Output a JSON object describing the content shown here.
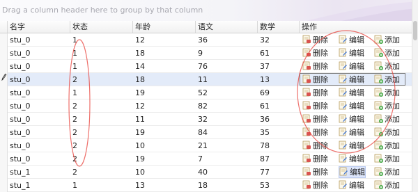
{
  "group_panel": {
    "hint": "Drag a column header here to group by that column"
  },
  "columns": {
    "name": "名字",
    "status": "状态",
    "age": "年龄",
    "chinese": "语文",
    "math": "数学",
    "ops": "操作"
  },
  "actions": {
    "delete": "删除",
    "edit": "编辑",
    "add": "添加"
  },
  "icons": {
    "delete": "delete-doc-icon",
    "edit": "edit-doc-icon",
    "add": "add-doc-icon",
    "row_editing": "pencil-icon"
  },
  "colors": {
    "selected_row": "#e3ebf9",
    "annotation": "#e8403a"
  },
  "selected_row_index": 3,
  "rows": [
    {
      "name": "stu_0",
      "status": "1",
      "age": "12",
      "chinese": "36",
      "math": "32"
    },
    {
      "name": "stu_0",
      "status": "1",
      "age": "18",
      "chinese": "9",
      "math": "61"
    },
    {
      "name": "stu_0",
      "status": "1",
      "age": "14",
      "chinese": "76",
      "math": "37"
    },
    {
      "name": "stu_0",
      "status": "2",
      "age": "18",
      "chinese": "11",
      "math": "13"
    },
    {
      "name": "stu_0",
      "status": "1",
      "age": "19",
      "chinese": "52",
      "math": "69"
    },
    {
      "name": "stu_0",
      "status": "2",
      "age": "12",
      "chinese": "82",
      "math": "61"
    },
    {
      "name": "stu_0",
      "status": "2",
      "age": "11",
      "chinese": "32",
      "math": "36"
    },
    {
      "name": "stu_0",
      "status": "2",
      "age": "19",
      "chinese": "84",
      "math": "35"
    },
    {
      "name": "stu_0",
      "status": "2",
      "age": "10",
      "chinese": "21",
      "math": "78"
    },
    {
      "name": "stu_0",
      "status": "2",
      "age": "19",
      "chinese": "7",
      "math": "87"
    },
    {
      "name": "stu_1",
      "status": "2",
      "age": "10",
      "chinese": "40",
      "math": "77"
    },
    {
      "name": "stu_1",
      "status": "1",
      "age": "13",
      "chinese": "18",
      "math": "53"
    }
  ]
}
